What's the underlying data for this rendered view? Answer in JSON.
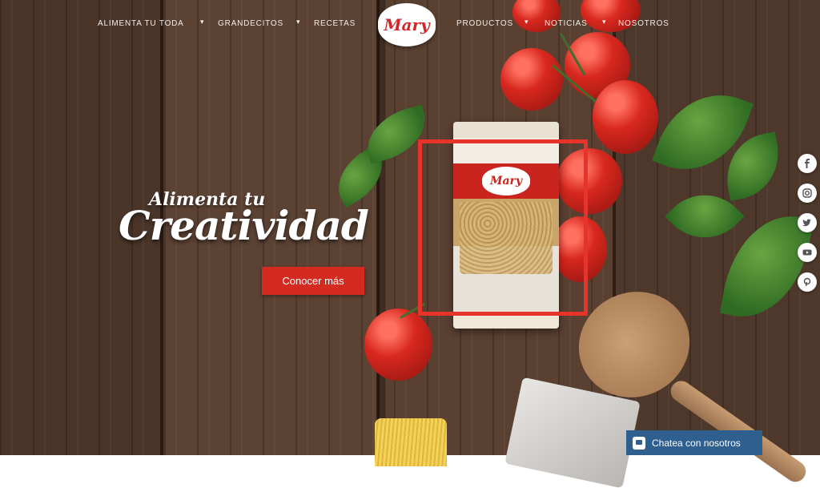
{
  "nav": {
    "items_left": [
      {
        "label": "ALIMENTA TU TODA"
      },
      {
        "label": "GRANDECITOS"
      },
      {
        "label": "RECETAS"
      }
    ],
    "items_right": [
      {
        "label": "PRODUCTOS"
      },
      {
        "label": "NOTICIAS"
      },
      {
        "label": "NOSOTROS"
      }
    ],
    "separator": "▾",
    "logo_text": "Mary"
  },
  "hero": {
    "subtitle": "Alimenta tu",
    "title": "Creatividad",
    "cta_label": "Conocer más"
  },
  "product": {
    "brand": "Mary"
  },
  "social": [
    {
      "icon": "facebook-icon"
    },
    {
      "icon": "instagram-icon"
    },
    {
      "icon": "twitter-icon"
    },
    {
      "icon": "youtube-icon"
    },
    {
      "icon": "pinterest-icon"
    }
  ],
  "chat": {
    "label": "Chatea con nosotros"
  },
  "colors": {
    "accent_red": "#d42a20",
    "chat_blue": "#2f5f8f",
    "wood": "#4f3a2c"
  }
}
